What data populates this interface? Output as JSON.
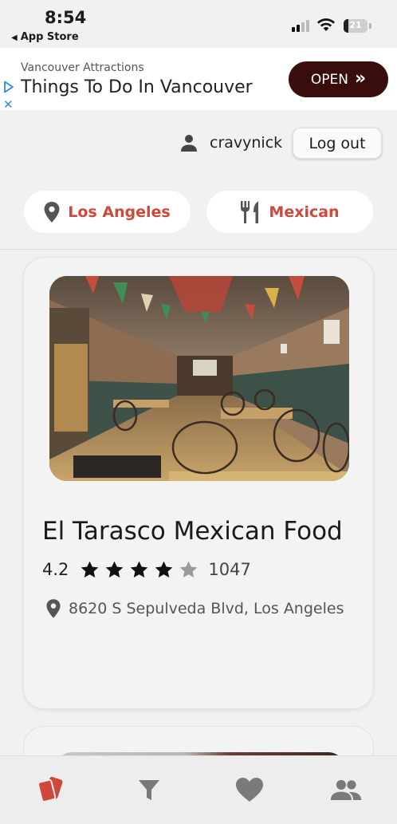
{
  "status_bar": {
    "time": "8:54",
    "back_label": "App Store",
    "battery": "21"
  },
  "ad": {
    "subtitle": "Vancouver Attractions",
    "title": "Things To Do In Vancouver",
    "button_label": "OPEN",
    "button_arrows": "»"
  },
  "user": {
    "username": "cravynick",
    "logout_label": "Log out"
  },
  "filters": {
    "location": "Los Angeles",
    "cuisine": "Mexican"
  },
  "restaurant": {
    "name": "El Tarasco Mexican Food",
    "rating": "4.2",
    "stars_filled": 4,
    "stars_total": 5,
    "review_count": "1047",
    "address": "8620 S Sepulveda Blvd, Los Angeles"
  },
  "tabs": [
    {
      "icon": "cards-icon",
      "active": true
    },
    {
      "icon": "filter-icon",
      "active": false
    },
    {
      "icon": "heart-icon",
      "active": false
    },
    {
      "icon": "group-icon",
      "active": false
    }
  ],
  "colors": {
    "accent": "#d0473c",
    "ad_button": "#3a0d0d",
    "tab_inactive": "#7a7a7a",
    "star": "#111111",
    "star_empty": "#9a9a9a"
  }
}
